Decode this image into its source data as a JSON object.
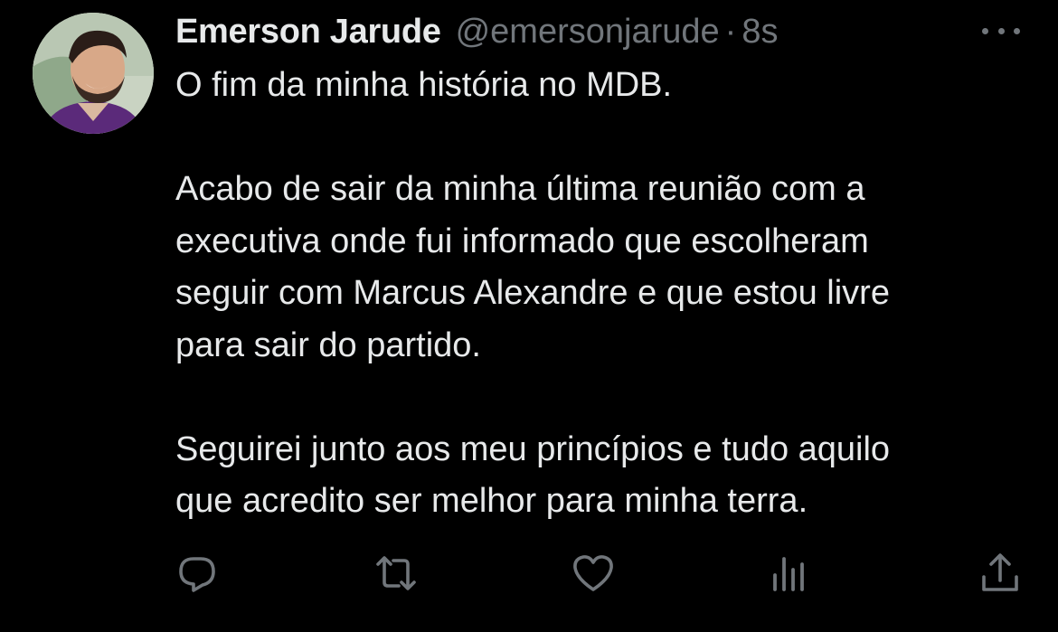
{
  "author": {
    "name": "Emerson Jarude",
    "handle": "@emersonjarude",
    "separator": "·",
    "time": "8s"
  },
  "tweet": {
    "paragraphs": [
      [
        "O fim da minha história no MDB."
      ],
      [
        "Acabo de sair da minha última reunião com a",
        "executiva onde fui informado que escolheram",
        "seguir com Marcus Alexandre e que estou livre",
        "para sair do partido."
      ],
      [
        "Seguirei junto aos meu princípios e tudo aquilo",
        "que acredito ser melhor para minha terra."
      ]
    ]
  },
  "actions": [
    {
      "name": "reply-icon"
    },
    {
      "name": "retweet-icon"
    },
    {
      "name": "like-icon"
    },
    {
      "name": "views-icon"
    },
    {
      "name": "share-icon"
    }
  ],
  "colors": {
    "background": "#000000",
    "text": "#e7e9ea",
    "muted": "#71767b"
  }
}
